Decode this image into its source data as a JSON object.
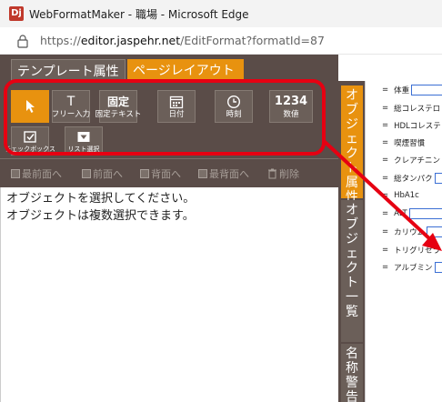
{
  "window": {
    "app_icon_label": "Dj",
    "title": "WebFormatMaker - 職場 - Microsoft Edge"
  },
  "address": {
    "scheme": "https://",
    "host": "editor.jaspehr.net",
    "path": "/EditFormat?formatId=87"
  },
  "tabs": {
    "template": "テンプレート属性",
    "page": "ページレイアウト"
  },
  "tools": [
    {
      "name": "select",
      "label": ""
    },
    {
      "name": "free-input",
      "icon": "T",
      "label": "フリー入力"
    },
    {
      "name": "fixed-text",
      "icon": "固定",
      "label": "固定テキスト"
    },
    {
      "name": "date",
      "label": "日付"
    },
    {
      "name": "time",
      "label": "時刻"
    },
    {
      "name": "number",
      "icon": "1234",
      "label": "数値"
    },
    {
      "name": "checkbox",
      "label": "チェックボックス"
    },
    {
      "name": "list-select",
      "label": "リスト選択"
    }
  ],
  "arrange": {
    "front_most": "最前面へ",
    "front": "前面へ",
    "back": "背面へ",
    "back_most": "最背面へ",
    "delete": "削除"
  },
  "messages": {
    "line1": "オブジェクトを選択してください。",
    "line2": "オブジェクトは複数選択できます。"
  },
  "vtabs": {
    "properties": [
      "オ",
      "ブ",
      "ジ",
      "ェ",
      "ク",
      "ト",
      "属",
      "性"
    ],
    "list": [
      "オ",
      "ブ",
      "ジ",
      "ェ",
      "ク",
      "ト",
      "一",
      "覧"
    ],
    "warnings": [
      "名",
      "称",
      "警",
      "告"
    ]
  },
  "preview_rows": [
    {
      "eq": "=",
      "label": "身長",
      "field": true
    },
    {
      "eq": "=",
      "label": "体重",
      "field": true
    },
    {
      "eq": "=",
      "label": "総コレステロ",
      "field": false
    },
    {
      "eq": "=",
      "label": "HDLコレステ",
      "field": false
    },
    {
      "eq": "=",
      "label": "喫煙習慣",
      "field": false
    },
    {
      "eq": "=",
      "label": "クレアチニン",
      "field": false
    },
    {
      "eq": "=",
      "label": "総タンパク",
      "field": true
    },
    {
      "eq": "=",
      "label": "HbA1c",
      "field": false
    },
    {
      "eq": "=",
      "label": "ALT",
      "field": true
    },
    {
      "eq": "=",
      "label": "カリウム",
      "field": true
    },
    {
      "eq": "=",
      "label": "トリグリセラ",
      "field": false
    },
    {
      "eq": "=",
      "label": "アルブミン",
      "field": true
    }
  ],
  "colors": {
    "accent": "#e8920f",
    "panel": "#5a4c48",
    "annotation": "#e60012",
    "field_border": "#3b6fd4"
  }
}
